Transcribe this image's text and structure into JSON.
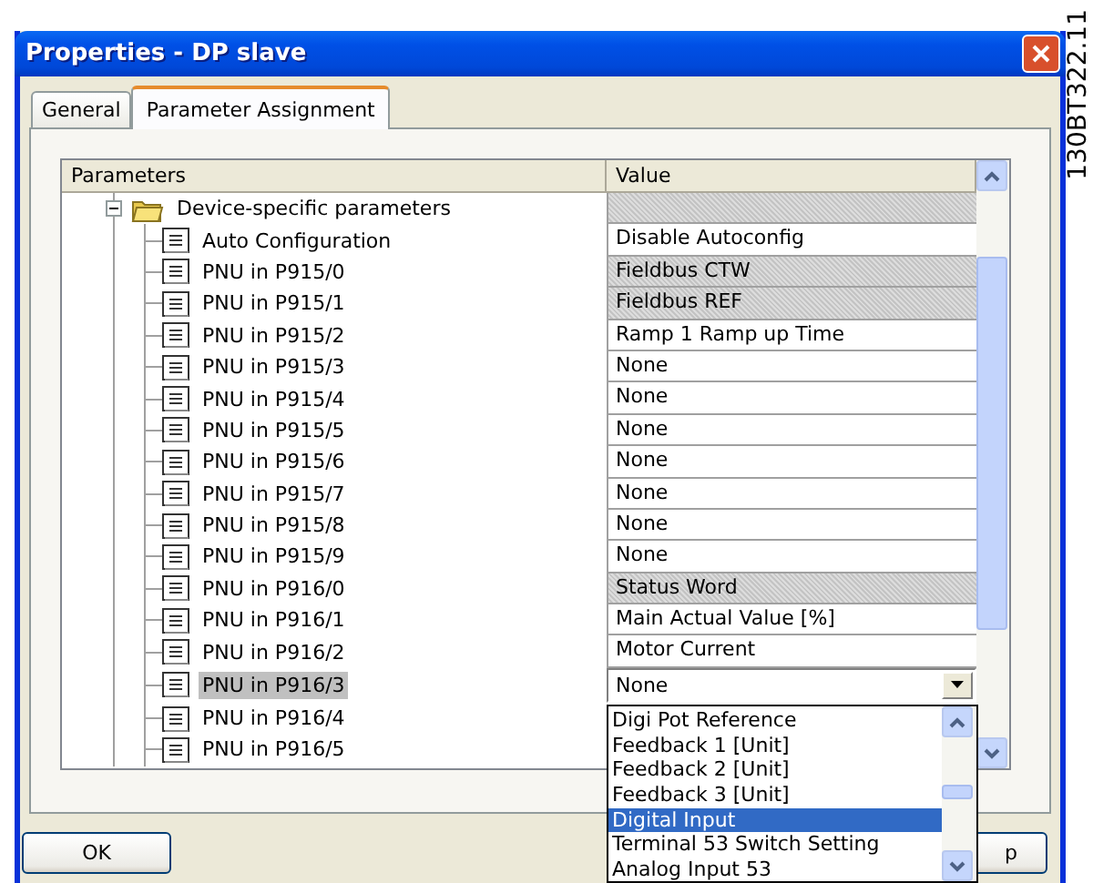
{
  "window": {
    "title": "Properties - DP slave"
  },
  "tabs": [
    {
      "label": "General",
      "selected": false
    },
    {
      "label": "Parameter Assignment",
      "selected": true
    }
  ],
  "tree": {
    "columns": [
      "Parameters",
      "Value"
    ],
    "groups": [
      {
        "label": "Device-specific parameters",
        "expanded": true,
        "readonly": true,
        "children": [
          {
            "label": "Auto Configuration",
            "value": "Disable Autoconfig",
            "readonly": false,
            "selected": false,
            "kind": "text"
          },
          {
            "label": "PNU in P915/0",
            "value": "Fieldbus CTW",
            "readonly": true,
            "selected": false,
            "kind": "text"
          },
          {
            "label": "PNU in P915/1",
            "value": "Fieldbus REF",
            "readonly": true,
            "selected": false,
            "kind": "text"
          },
          {
            "label": "PNU in P915/2",
            "value": "Ramp 1 Ramp up Time",
            "readonly": false,
            "selected": false,
            "kind": "text"
          },
          {
            "label": "PNU in P915/3",
            "value": "None",
            "readonly": false,
            "selected": false,
            "kind": "text"
          },
          {
            "label": "PNU in P915/4",
            "value": "None",
            "readonly": false,
            "selected": false,
            "kind": "text"
          },
          {
            "label": "PNU in P915/5",
            "value": "None",
            "readonly": false,
            "selected": false,
            "kind": "text"
          },
          {
            "label": "PNU in P915/6",
            "value": "None",
            "readonly": false,
            "selected": false,
            "kind": "text"
          },
          {
            "label": "PNU in P915/7",
            "value": "None",
            "readonly": false,
            "selected": false,
            "kind": "text"
          },
          {
            "label": "PNU in P915/8",
            "value": "None",
            "readonly": false,
            "selected": false,
            "kind": "text"
          },
          {
            "label": "PNU in P915/9",
            "value": "None",
            "readonly": false,
            "selected": false,
            "kind": "text"
          },
          {
            "label": "PNU in P916/0",
            "value": "Status Word",
            "readonly": true,
            "selected": false,
            "kind": "text"
          },
          {
            "label": "PNU in P916/1",
            "value": "Main Actual Value [%]",
            "readonly": false,
            "selected": false,
            "kind": "text"
          },
          {
            "label": "PNU in P916/2",
            "value": "Motor Current",
            "readonly": false,
            "selected": false,
            "kind": "text"
          },
          {
            "label": "PNU in P916/3",
            "value": "None",
            "selected": true,
            "kind": "combo"
          },
          {
            "label": "PNU in P916/4",
            "selected": false,
            "kind": "text"
          },
          {
            "label": "PNU in P916/5",
            "selected": false,
            "kind": "text"
          }
        ]
      }
    ]
  },
  "dropdown": {
    "items": [
      {
        "label": "Digi Pot Reference",
        "selected": false
      },
      {
        "label": "Feedback 1 [Unit]",
        "selected": false
      },
      {
        "label": "Feedback 2 [Unit]",
        "selected": false
      },
      {
        "label": "Feedback 3 [Unit]",
        "selected": false
      },
      {
        "label": "Digital Input",
        "selected": true
      },
      {
        "label": "Terminal 53 Switch Setting",
        "selected": false
      },
      {
        "label": "Analog Input 53",
        "selected": false
      }
    ]
  },
  "buttons": [
    {
      "label": "OK"
    },
    {
      "label": "p"
    }
  ],
  "figure_code": "130BT322.11"
}
